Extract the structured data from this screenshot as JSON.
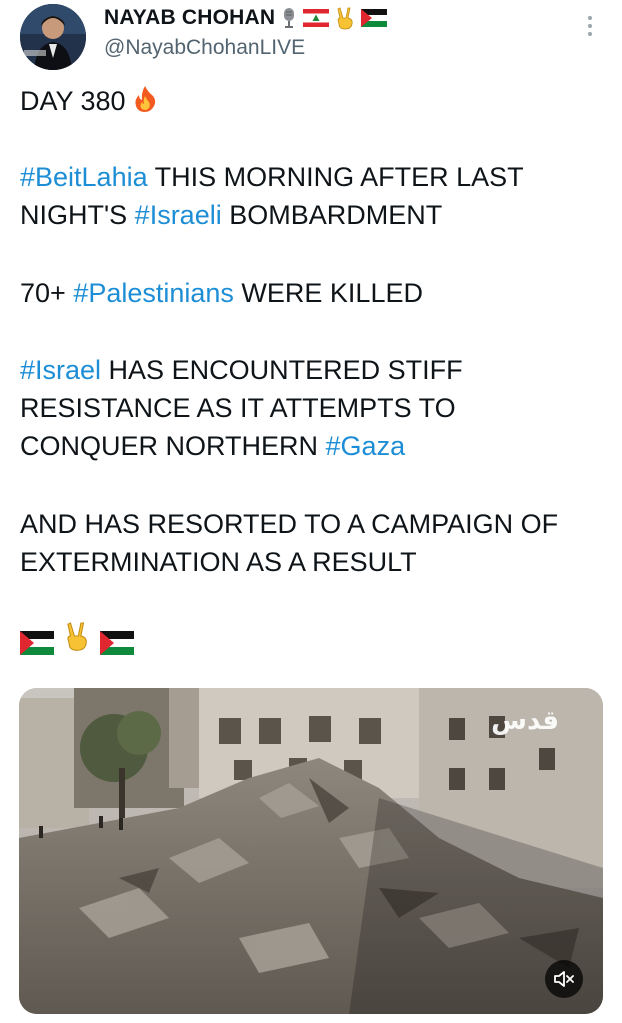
{
  "author": {
    "name": "NAYAB CHOHAN",
    "handle": "@NayabChohanLIVE",
    "badges": [
      "microphone-icon",
      "lebanon-flag-icon",
      "victory-hand-icon",
      "palestine-flag-icon"
    ]
  },
  "tweet": {
    "day": "DAY 380",
    "day_emoji": "fire-icon",
    "p1_tag1": "#BeitLahia",
    "p1_text1": " THIS MORNING AFTER LAST",
    "p1_text2": "NIGHT'S ",
    "p1_tag2": "#Israeli",
    "p1_text3": " BOMBARDMENT",
    "p2_text1": "70+ ",
    "p2_tag1": "#Palestinians",
    "p2_text2": " WERE KILLED",
    "p3_tag1": "#Israel",
    "p3_text1": " HAS ENCOUNTERED STIFF",
    "p3_line2": "RESISTANCE AS IT ATTEMPTS TO",
    "p3_text2": "CONQUER NORTHERN ",
    "p3_tag2": "#Gaza",
    "p4_line1": "AND HAS RESORTED TO A CAMPAIGN OF",
    "p4_line2": "EXTERMINATION AS A RESULT",
    "footer_emojis": [
      "palestine-flag-icon",
      "victory-hand-icon",
      "palestine-flag-icon"
    ]
  },
  "media": {
    "watermark": "قدس",
    "mute_icon": "speaker-muted-icon"
  },
  "colors": {
    "hashtag": "#1d8ed6",
    "text": "#0f1419",
    "handle": "#536471"
  }
}
